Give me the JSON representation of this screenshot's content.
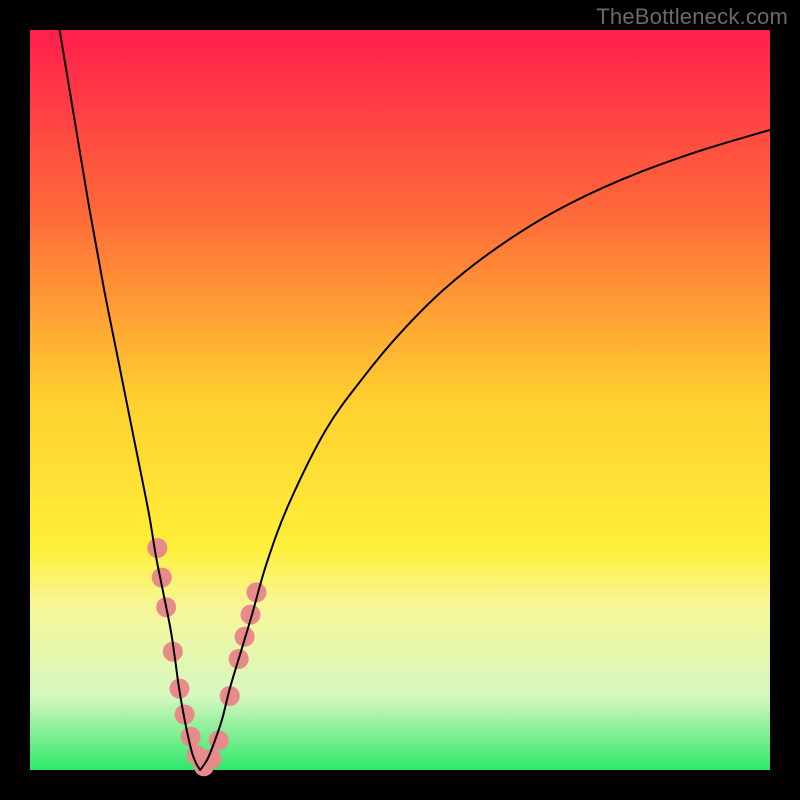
{
  "watermark": "TheBottleneck.com",
  "chart_data": {
    "type": "line",
    "title": "",
    "xlabel": "",
    "ylabel": "",
    "xlim": [
      0,
      100
    ],
    "ylim": [
      0,
      100
    ],
    "gradient": {
      "stops": [
        {
          "pct": 0,
          "color": "#ff1f4c"
        },
        {
          "pct": 25,
          "color": "#ff6a3a"
        },
        {
          "pct": 50,
          "color": "#ffd02f"
        },
        {
          "pct": 70,
          "color": "#ffef3a"
        },
        {
          "pct": 78,
          "color": "#f7f79a"
        },
        {
          "pct": 90,
          "color": "#d6f7c0"
        },
        {
          "pct": 100,
          "color": "#2ee86a"
        }
      ]
    },
    "series": [
      {
        "name": "left-branch",
        "x": [
          4,
          6,
          8,
          10,
          12,
          14,
          16,
          17,
          18,
          19,
          19.6,
          20,
          20.4,
          20.8,
          21.2,
          21.6,
          22,
          22.5,
          23
        ],
        "y": [
          100,
          88,
          76,
          65,
          55,
          45,
          35,
          29,
          24,
          19,
          15,
          12,
          9.5,
          7.3,
          5.3,
          3.5,
          2.0,
          0.8,
          0
        ]
      },
      {
        "name": "right-branch",
        "x": [
          23,
          24,
          25,
          26,
          27,
          28.5,
          30,
          32,
          35,
          40,
          45,
          50,
          56,
          63,
          71,
          80,
          90,
          100
        ],
        "y": [
          0,
          1.5,
          4,
          7,
          11,
          16,
          21,
          28,
          36,
          46,
          53,
          59,
          65,
          70.5,
          75.5,
          79.8,
          83.5,
          86.5
        ]
      }
    ],
    "markers": {
      "name": "highlight-dots",
      "color": "#e98a8a",
      "radius": 10,
      "points": [
        {
          "x": 17.2,
          "y": 30
        },
        {
          "x": 17.8,
          "y": 26
        },
        {
          "x": 18.4,
          "y": 22
        },
        {
          "x": 19.3,
          "y": 16
        },
        {
          "x": 20.2,
          "y": 11
        },
        {
          "x": 20.9,
          "y": 7.5
        },
        {
          "x": 21.7,
          "y": 4.5
        },
        {
          "x": 22.5,
          "y": 2
        },
        {
          "x": 23.5,
          "y": 0.5
        },
        {
          "x": 24.5,
          "y": 1.5
        },
        {
          "x": 25.5,
          "y": 4
        },
        {
          "x": 27.0,
          "y": 10
        },
        {
          "x": 28.2,
          "y": 15
        },
        {
          "x": 29.0,
          "y": 18
        },
        {
          "x": 29.8,
          "y": 21
        },
        {
          "x": 30.6,
          "y": 24
        }
      ]
    },
    "curve_style": {
      "stroke": "#000000",
      "width": 2
    }
  }
}
